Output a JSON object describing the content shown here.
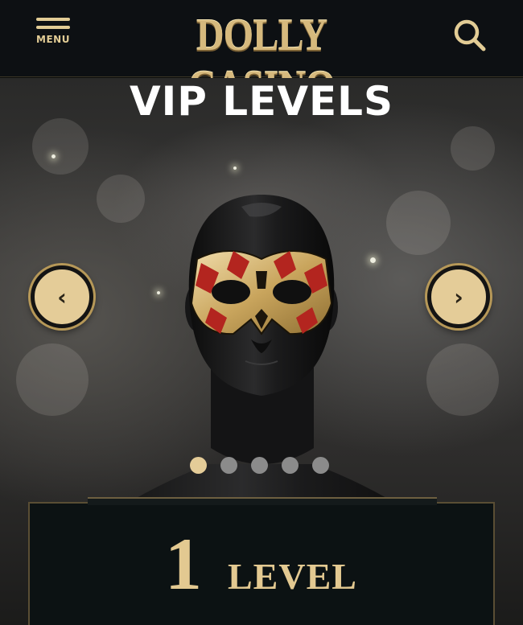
{
  "header": {
    "menu_label": "MENU",
    "logo_text": "DOLLY CASINO",
    "search_icon": "search-icon",
    "accent_color": "#e2cc95"
  },
  "hero": {
    "title": "VIP LEVELS",
    "prev_icon": "‹",
    "next_icon": "›",
    "slides_total": 5,
    "active_slide": 1
  },
  "level_card": {
    "number": "1",
    "word": "LEVEL"
  }
}
